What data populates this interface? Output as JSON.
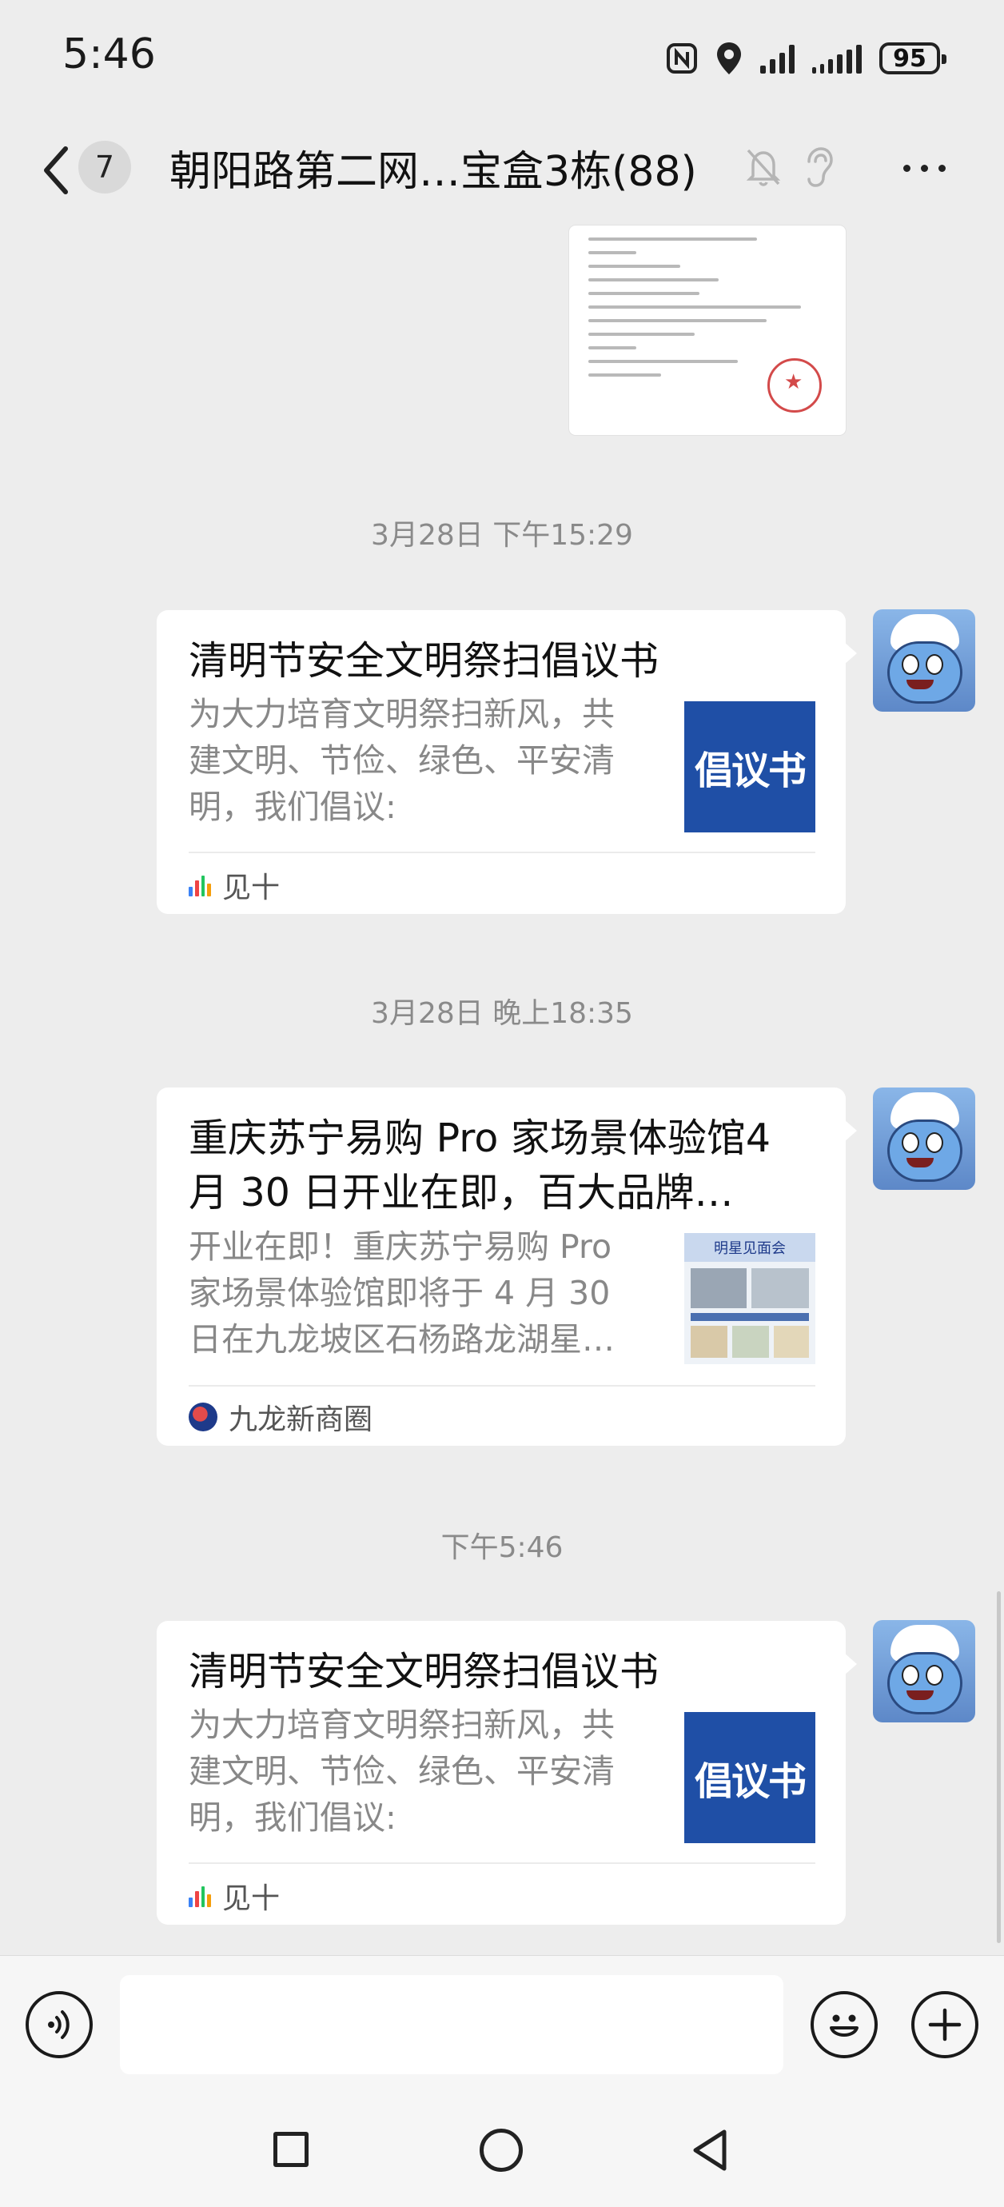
{
  "status_bar": {
    "time": "5:46",
    "battery": "95"
  },
  "header": {
    "unread_count": "7",
    "title": "朝阳路第二网…宝盒3栋(88)"
  },
  "timestamps": [
    "3月28日 下午15:29",
    "3月28日 晚上18:35",
    "下午5:46"
  ],
  "messages": [
    {
      "title": "清明节安全文明祭扫倡议书",
      "description": "为大力培育文明祭扫新风，共建文明、节俭、绿色、平安清明，我们倡议:",
      "thumbnail_text": "倡议书",
      "source": "见十"
    },
    {
      "title": "重庆苏宁易购 Pro 家场景体验馆4 月 30 日开业在即，百大品牌…",
      "description": "开业在即！重庆苏宁易购 Pro 家场景体验馆即将于 4 月 30 日在九龙坡区石杨路龙湖星…",
      "thumbnail_text": "明星见面会",
      "source": "九龙新商圈"
    },
    {
      "title": "清明节安全文明祭扫倡议书",
      "description": "为大力培育文明祭扫新风，共建文明、节俭、绿色、平安清明，我们倡议:",
      "thumbnail_text": "倡议书",
      "source": "见十"
    }
  ],
  "colors": {
    "background": "#EDEDED",
    "thumbnail_blue": "#1F4FA6"
  },
  "icons": {
    "back": "chevron-left-icon",
    "mute": "bell-slash-icon",
    "earpiece": "ear-icon",
    "more": "ellipsis-icon",
    "voice": "voice-icon",
    "emoji": "smiley-icon",
    "add": "plus-icon"
  }
}
